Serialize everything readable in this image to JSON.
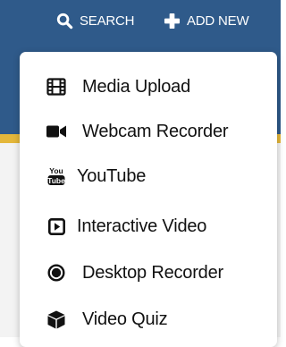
{
  "header": {
    "search_label": "SEARCH",
    "add_new_label": "ADD NEW",
    "background_color": "#2f5a8a",
    "accent_strip_color": "#e4b73a"
  },
  "menu": {
    "items": [
      {
        "label": "Media Upload",
        "icon": "film-icon"
      },
      {
        "label": "Webcam Recorder",
        "icon": "video-camera-icon"
      },
      {
        "label": "YouTube",
        "icon": "youtube-icon",
        "icon_text_top": "You",
        "icon_text_bottom": "Tube"
      },
      {
        "label": "Interactive Video",
        "icon": "play-square-icon"
      },
      {
        "label": "Desktop Recorder",
        "icon": "record-circle-icon"
      },
      {
        "label": "Video Quiz",
        "icon": "cube-icon"
      }
    ]
  }
}
